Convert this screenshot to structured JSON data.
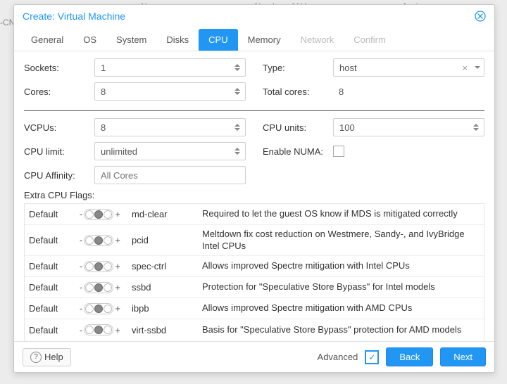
{
  "underlay": {
    "col_name": "Name",
    "col_num_lvs": "Number of LVs",
    "col_assignee": "Assignee",
    "left_fragment": "-CNX)"
  },
  "modal": {
    "title": "Create: Virtual Machine"
  },
  "tabs": {
    "general": "General",
    "os": "OS",
    "system": "System",
    "disks": "Disks",
    "cpu": "CPU",
    "memory": "Memory",
    "network": "Network",
    "confirm": "Confirm"
  },
  "form": {
    "sockets_label": "Sockets:",
    "sockets_value": "1",
    "cores_label": "Cores:",
    "cores_value": "8",
    "type_label": "Type:",
    "type_value": "host",
    "total_cores_label": "Total cores:",
    "total_cores_value": "8",
    "vcpus_label": "VCPUs:",
    "vcpus_value": "8",
    "cpu_limit_label": "CPU limit:",
    "cpu_limit_value": "unlimited",
    "cpu_affinity_label": "CPU Affinity:",
    "cpu_affinity_placeholder": "All Cores",
    "cpu_units_label": "CPU units:",
    "cpu_units_value": "100",
    "enable_numa_label": "Enable NUMA:"
  },
  "flags_label": "Extra CPU Flags:",
  "flags": [
    {
      "state": "Default",
      "name": "md-clear",
      "desc": "Required to let the guest OS know if MDS is mitigated correctly"
    },
    {
      "state": "Default",
      "name": "pcid",
      "desc": "Meltdown fix cost reduction on Westmere, Sandy-, and IvyBridge Intel CPUs"
    },
    {
      "state": "Default",
      "name": "spec-ctrl",
      "desc": "Allows improved Spectre mitigation with Intel CPUs"
    },
    {
      "state": "Default",
      "name": "ssbd",
      "desc": "Protection for \"Speculative Store Bypass\" for Intel models"
    },
    {
      "state": "Default",
      "name": "ibpb",
      "desc": "Allows improved Spectre mitigation with AMD CPUs"
    },
    {
      "state": "Default",
      "name": "virt-ssbd",
      "desc": "Basis for \"Speculative Store Bypass\" protection for AMD models"
    }
  ],
  "footer": {
    "help": "Help",
    "advanced": "Advanced",
    "back": "Back",
    "next": "Next"
  }
}
